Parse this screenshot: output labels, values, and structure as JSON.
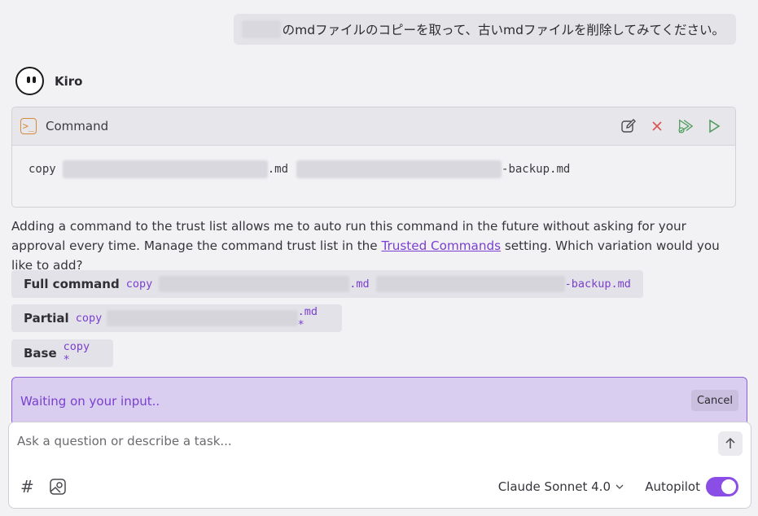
{
  "user_message": {
    "text": "のmdファイルのコピーを取って、古いmdファイルを削除してみてください。"
  },
  "agent": {
    "name": "Kiro"
  },
  "command_card": {
    "title": "Command",
    "icon": "terminal-icon",
    "actions": [
      "edit-icon",
      "reject-icon",
      "trust-icon",
      "run-icon"
    ],
    "body": {
      "cmd": "copy",
      "src_suffix": ".md",
      "dst_suffix": "-backup.md"
    }
  },
  "explanation": {
    "before_link": "Adding a command to the trust list allows me to auto run this command in the future without asking for your approval every time. Manage the command trust list in the ",
    "link": "Trusted Commands",
    "after_link": " setting. Which variation would you like to add?"
  },
  "options": [
    {
      "label": "Full command",
      "code_prefix": "copy",
      "mid": ".md",
      "suffix": "-backup.md"
    },
    {
      "label": "Partial",
      "code_prefix": "copy",
      "suffix": ".md *"
    },
    {
      "label": "Base",
      "code_prefix": "copy *"
    }
  ],
  "waiting": {
    "text": "Waiting on your input..",
    "cancel_label": "Cancel"
  },
  "composer": {
    "placeholder": "Ask a question or describe a task...",
    "model": "Claude Sonnet 4.0",
    "autopilot_label": "Autopilot",
    "autopilot_on": true
  },
  "colors": {
    "accent": "#7a3fd0",
    "toggle": "#8a4ee6",
    "terminal": "#d68a3c",
    "reject": "#d9534f",
    "trust": "#4a9a5a"
  }
}
